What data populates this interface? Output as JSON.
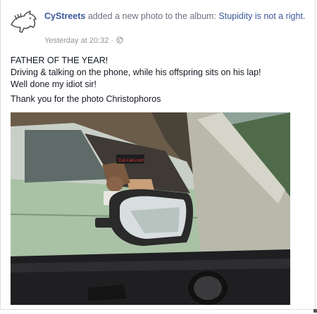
{
  "post": {
    "author": "CyStreets",
    "action_text": " added a new photo to the album: ",
    "album_title": "Stupidity is not a right.",
    "timestamp": "Yesterday at 20:32",
    "separator": "·",
    "privacy_icon": "globe-icon",
    "lines": [
      "FATHER OF THE YEAR!",
      "Driving & talking on the phone, while his offspring sits on his lap!",
      "Well done my idiot sir!"
    ],
    "thanks": "Thank you for the photo Christophoros",
    "photo_sticker_text": "Cut-Cars.com"
  },
  "colors": {
    "link": "#3b5998",
    "meta": "#90949c",
    "text": "#141823"
  }
}
